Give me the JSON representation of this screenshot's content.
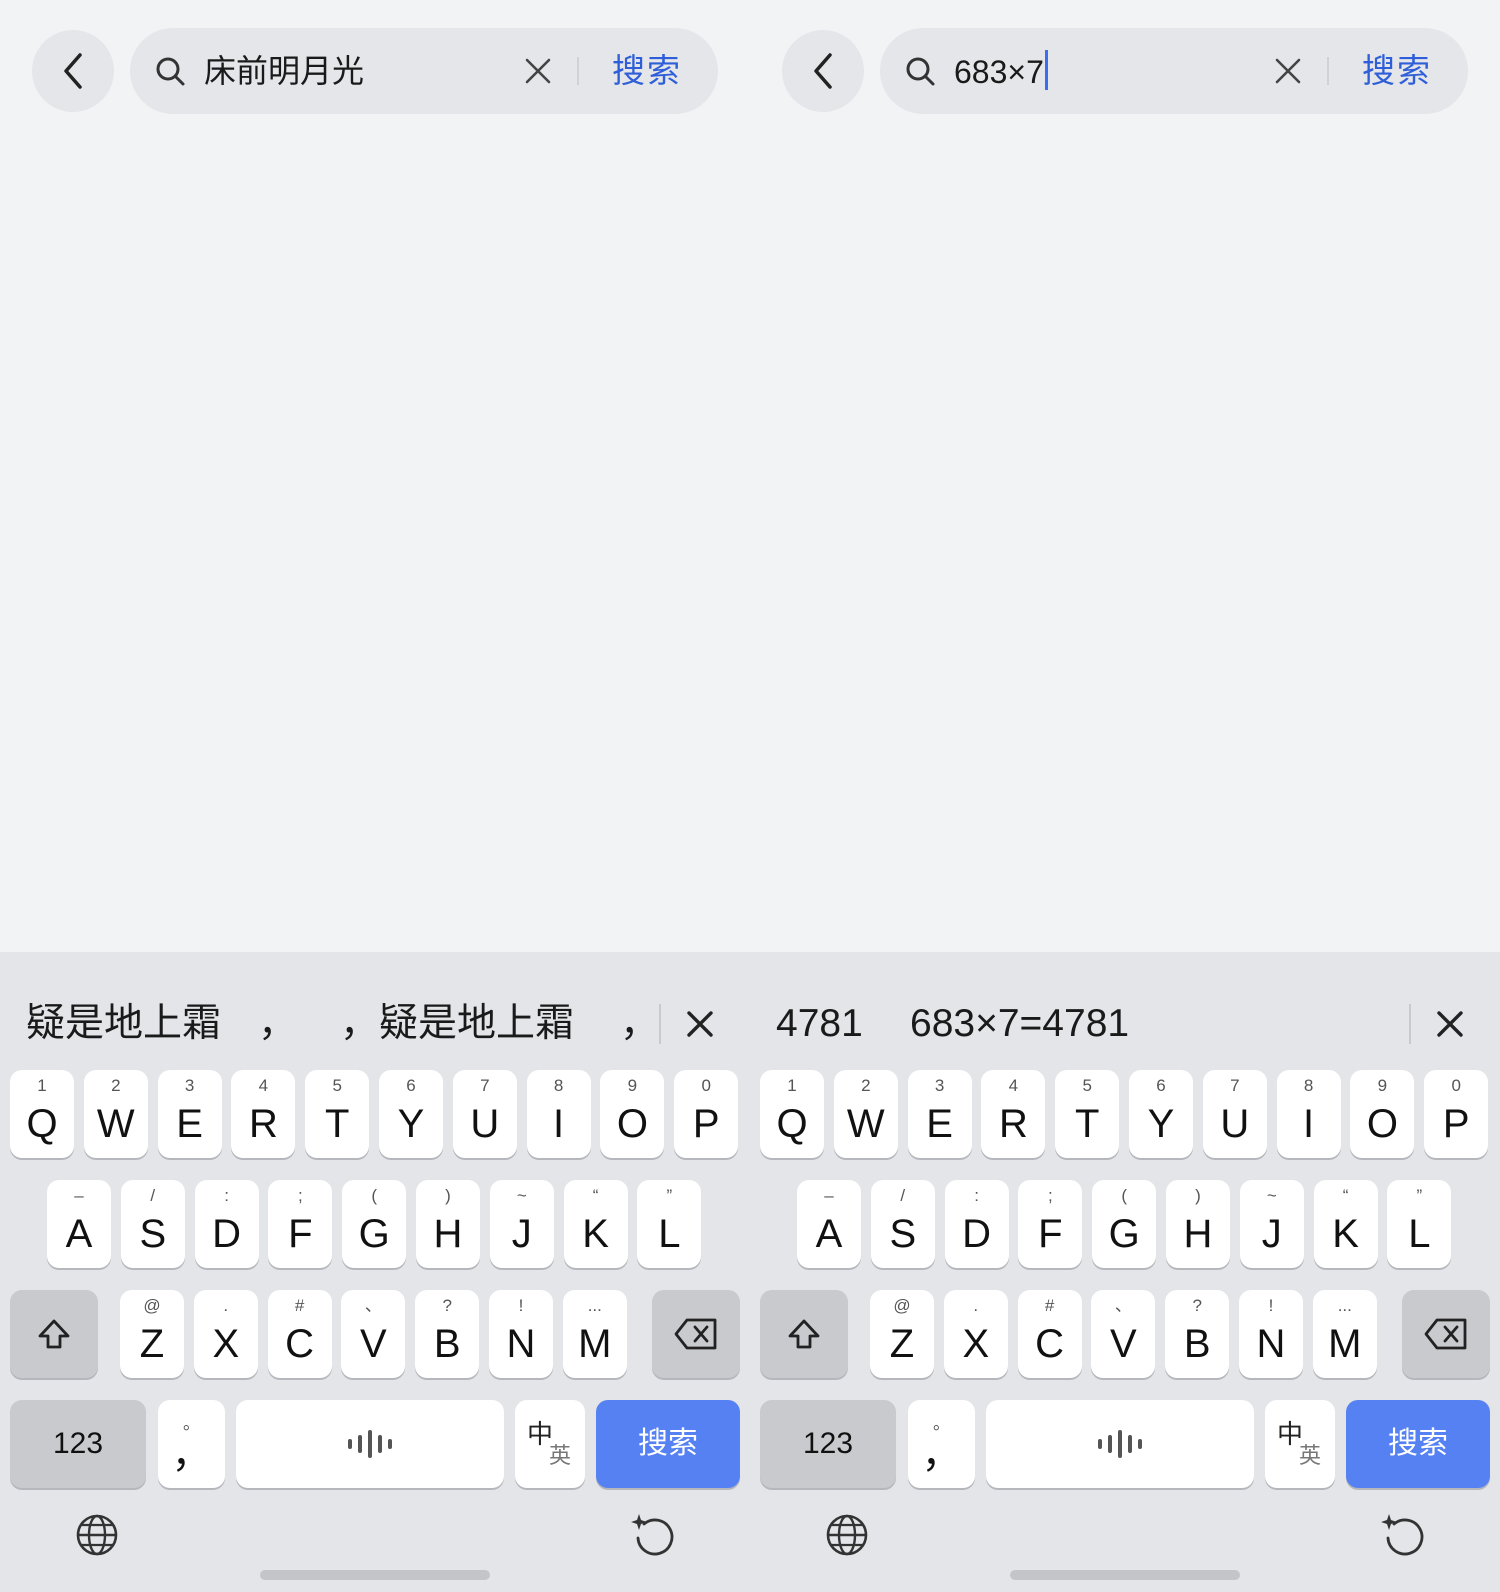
{
  "left": {
    "search": {
      "query": "床前明月光",
      "button_label": "搜索"
    },
    "candidates": [
      "疑是地上霜",
      "，",
      "，疑是地上霜",
      "，"
    ],
    "keyboard": {
      "row1": [
        {
          "hint": "1",
          "key": "Q"
        },
        {
          "hint": "2",
          "key": "W"
        },
        {
          "hint": "3",
          "key": "E"
        },
        {
          "hint": "4",
          "key": "R"
        },
        {
          "hint": "5",
          "key": "T"
        },
        {
          "hint": "6",
          "key": "Y"
        },
        {
          "hint": "7",
          "key": "U"
        },
        {
          "hint": "8",
          "key": "I"
        },
        {
          "hint": "9",
          "key": "O"
        },
        {
          "hint": "0",
          "key": "P"
        }
      ],
      "row2": [
        {
          "hint": "–",
          "key": "A"
        },
        {
          "hint": "/",
          "key": "S"
        },
        {
          "hint": ":",
          "key": "D"
        },
        {
          "hint": ";",
          "key": "F"
        },
        {
          "hint": "(",
          "key": "G"
        },
        {
          "hint": ")",
          "key": "H"
        },
        {
          "hint": "~",
          "key": "J"
        },
        {
          "hint": "“",
          "key": "K"
        },
        {
          "hint": "”",
          "key": "L"
        }
      ],
      "row3": [
        {
          "hint": "@",
          "key": "Z"
        },
        {
          "hint": ".",
          "key": "X"
        },
        {
          "hint": "#",
          "key": "C"
        },
        {
          "hint": "、",
          "key": "V"
        },
        {
          "hint": "?",
          "key": "B"
        },
        {
          "hint": "!",
          "key": "N"
        },
        {
          "hint": "...",
          "key": "M"
        }
      ],
      "num_label": "123",
      "punct_hint": "。",
      "punct_key": "，",
      "lang_top": "中",
      "lang_bottom": "英",
      "enter_label": "搜索"
    }
  },
  "right": {
    "search": {
      "query": "683×7",
      "button_label": "搜索"
    },
    "candidates": [
      "4781",
      "683×7=4781"
    ],
    "keyboard": {
      "row1": [
        {
          "hint": "1",
          "key": "Q"
        },
        {
          "hint": "2",
          "key": "W"
        },
        {
          "hint": "3",
          "key": "E"
        },
        {
          "hint": "4",
          "key": "R"
        },
        {
          "hint": "5",
          "key": "T"
        },
        {
          "hint": "6",
          "key": "Y"
        },
        {
          "hint": "7",
          "key": "U"
        },
        {
          "hint": "8",
          "key": "I"
        },
        {
          "hint": "9",
          "key": "O"
        },
        {
          "hint": "0",
          "key": "P"
        }
      ],
      "row2": [
        {
          "hint": "–",
          "key": "A"
        },
        {
          "hint": "/",
          "key": "S"
        },
        {
          "hint": ":",
          "key": "D"
        },
        {
          "hint": ";",
          "key": "F"
        },
        {
          "hint": "(",
          "key": "G"
        },
        {
          "hint": ")",
          "key": "H"
        },
        {
          "hint": "~",
          "key": "J"
        },
        {
          "hint": "“",
          "key": "K"
        },
        {
          "hint": "”",
          "key": "L"
        }
      ],
      "row3": [
        {
          "hint": "@",
          "key": "Z"
        },
        {
          "hint": ".",
          "key": "X"
        },
        {
          "hint": "#",
          "key": "C"
        },
        {
          "hint": "、",
          "key": "V"
        },
        {
          "hint": "?",
          "key": "B"
        },
        {
          "hint": "!",
          "key": "N"
        },
        {
          "hint": "...",
          "key": "M"
        }
      ],
      "num_label": "123",
      "punct_hint": "。",
      "punct_key": "，",
      "lang_top": "中",
      "lang_bottom": "英",
      "enter_label": "搜索"
    }
  },
  "icons": {
    "back": "chevron-left-icon",
    "search": "search-icon",
    "clear": "close-icon",
    "shift": "shift-icon",
    "backspace": "backspace-icon",
    "voice": "voice-wave-icon",
    "globe": "globe-icon",
    "rotate": "sparkle-rotate-icon"
  },
  "colors": {
    "accent": "#2e5fd8",
    "enter_key": "#5681f2",
    "caret": "#3b6df0"
  }
}
